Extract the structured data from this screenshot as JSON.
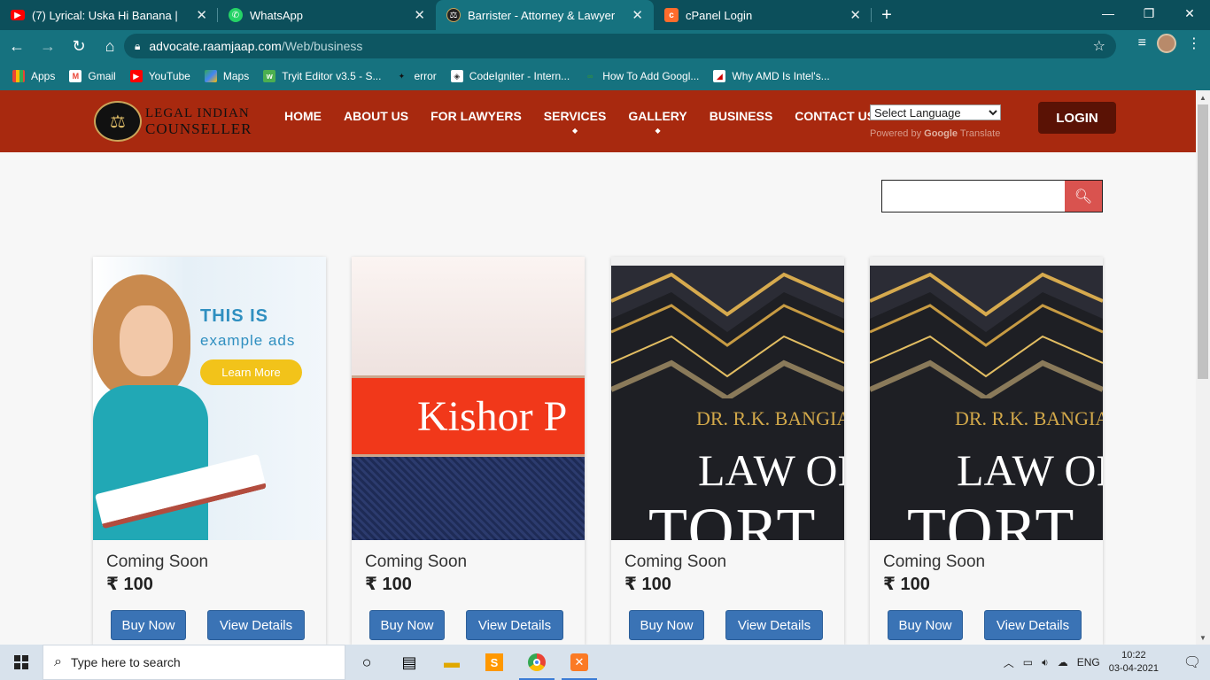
{
  "browser": {
    "tabs": [
      {
        "title": "(7) Lyrical: Uska Hi Banana | ",
        "icon": "youtube-icon",
        "color": "#ff0000"
      },
      {
        "title": "WhatsApp",
        "icon": "whatsapp-icon",
        "color": "#25d366"
      },
      {
        "title": "Barrister - Attorney & Lawyer",
        "icon": "scales-icon",
        "color": "#222222",
        "active": true
      },
      {
        "title": "cPanel Login",
        "icon": "cpanel-icon",
        "color": "#ff6c2c"
      }
    ],
    "new_tab": "+",
    "url": {
      "host": "advocate.raamjaap.com",
      "path": "/Web/business"
    },
    "bookmarks": [
      {
        "label": "Apps",
        "icon": "apps-grid-icon"
      },
      {
        "label": "Gmail",
        "icon": "gmail-icon"
      },
      {
        "label": "YouTube",
        "icon": "youtube-icon"
      },
      {
        "label": "Maps",
        "icon": "maps-icon"
      },
      {
        "label": "Tryit Editor v3.5 - S...",
        "icon": "w3schools-icon"
      },
      {
        "label": "error",
        "icon": "bird-icon"
      },
      {
        "label": "CodeIgniter - Intern...",
        "icon": "codeigniter-icon"
      },
      {
        "label": "How To Add Googl...",
        "icon": "geeks-icon"
      },
      {
        "label": "Why AMD Is Intel's...",
        "icon": "amd-icon"
      }
    ]
  },
  "site": {
    "logo": {
      "line1": "Legal Indian",
      "line2": "Counseller"
    },
    "nav": [
      {
        "label": "HOME",
        "has_dropdown": false
      },
      {
        "label": "ABOUT US",
        "has_dropdown": false
      },
      {
        "label": "FOR LAWYERS",
        "has_dropdown": false
      },
      {
        "label": "SERVICES",
        "has_dropdown": true
      },
      {
        "label": "GALLERY",
        "has_dropdown": true
      },
      {
        "label": "BUSINESS",
        "has_dropdown": false
      },
      {
        "label": "CONTACT US",
        "has_dropdown": false
      }
    ],
    "language": {
      "selected": "Select Language",
      "powered_by": "Powered by",
      "google": "Google",
      "translate": "Translate"
    },
    "login_label": "LOGIN",
    "search": {
      "value": ""
    },
    "colors": {
      "header_bg": "#a8290f",
      "login_bg": "#5a1205",
      "button_blue": "#3a73b5",
      "search_btn": "#d9534f"
    }
  },
  "products": [
    {
      "name": "Coming Soon",
      "price": "₹ 100",
      "buy_label": "Buy Now",
      "view_label": "View Details",
      "image": "example-ad",
      "ad": {
        "line1": "THIS IS",
        "line2": "example ads",
        "cta": "Learn More"
      }
    },
    {
      "name": "Coming Soon",
      "price": "₹ 100",
      "buy_label": "Buy Now",
      "view_label": "View Details",
      "image": "kishor-book",
      "cover_text": "Kishor P"
    },
    {
      "name": "Coming Soon",
      "price": "₹ 100",
      "buy_label": "Buy Now",
      "view_label": "View Details",
      "image": "tort-book",
      "cover": {
        "author": "DR. R.K. BANGIA",
        "title1": "LAW OF",
        "title2": "TORT"
      }
    },
    {
      "name": "Coming Soon",
      "price": "₹ 100",
      "buy_label": "Buy Now",
      "view_label": "View Details",
      "image": "tort-book",
      "cover": {
        "author": "DR. R.K. BANGIA",
        "title1": "LAW OF",
        "title2": "TORT"
      }
    }
  ],
  "taskbar": {
    "search_placeholder": "Type here to search",
    "apps": [
      "cortana-icon",
      "task-view-icon",
      "file-explorer-icon",
      "sublime-icon",
      "chrome-icon",
      "xampp-icon"
    ],
    "language": "ENG",
    "time": "10:22",
    "date": "03-04-2021"
  }
}
